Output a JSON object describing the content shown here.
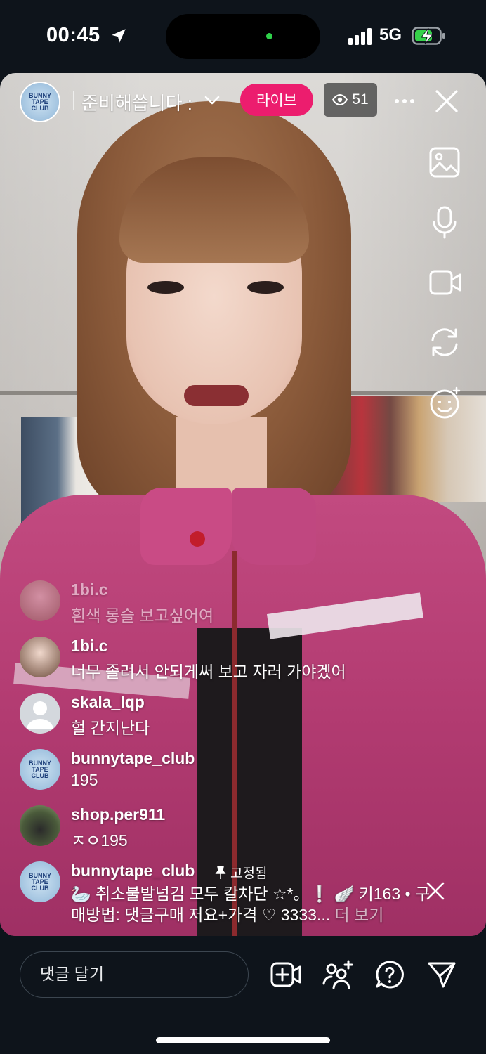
{
  "status_bar": {
    "time": "00:45",
    "network": "5G"
  },
  "live": {
    "title": "준비해씁니다 :",
    "live_label": "라이브",
    "viewer_count": "51"
  },
  "comments": [
    {
      "username": "1bi.c",
      "text": "흰색 롱슬 보고싶어여",
      "faded": true
    },
    {
      "username": "1bi.c",
      "text": "너무 졸려서 안되게써 보고 자러 가야겠어"
    },
    {
      "username": "skala_lqp",
      "text": "헐 간지난다"
    },
    {
      "username": "bunnytape_club",
      "text": "195"
    },
    {
      "username": "shop.per911",
      "text": "ㅈㅇ195"
    }
  ],
  "pinned": {
    "username": "bunnytape_club",
    "pinned_label": "고정됨",
    "text": "🦢 취소불발넘김 모두 칼차단 ☆*。❕ 🪽 키163 • 구매방법: 댓글구매 저요+가격 ♡ 3333...",
    "more_label": "더 보기"
  },
  "composer": {
    "placeholder": "댓글 달기"
  },
  "logo_text": "BUNNY TAPE CLUB",
  "colors": {
    "live_badge": "#ec1d6e",
    "background": "#0e141b"
  },
  "icons": [
    "location-arrow-icon",
    "signal-icon",
    "battery-charging-icon",
    "chevron-down-icon",
    "eye-icon",
    "more-icon",
    "close-icon",
    "image-icon",
    "microphone-icon",
    "video-camera-icon",
    "switch-camera-icon",
    "effects-icon",
    "pin-icon",
    "add-video-icon",
    "add-person-icon",
    "question-icon",
    "send-icon"
  ]
}
